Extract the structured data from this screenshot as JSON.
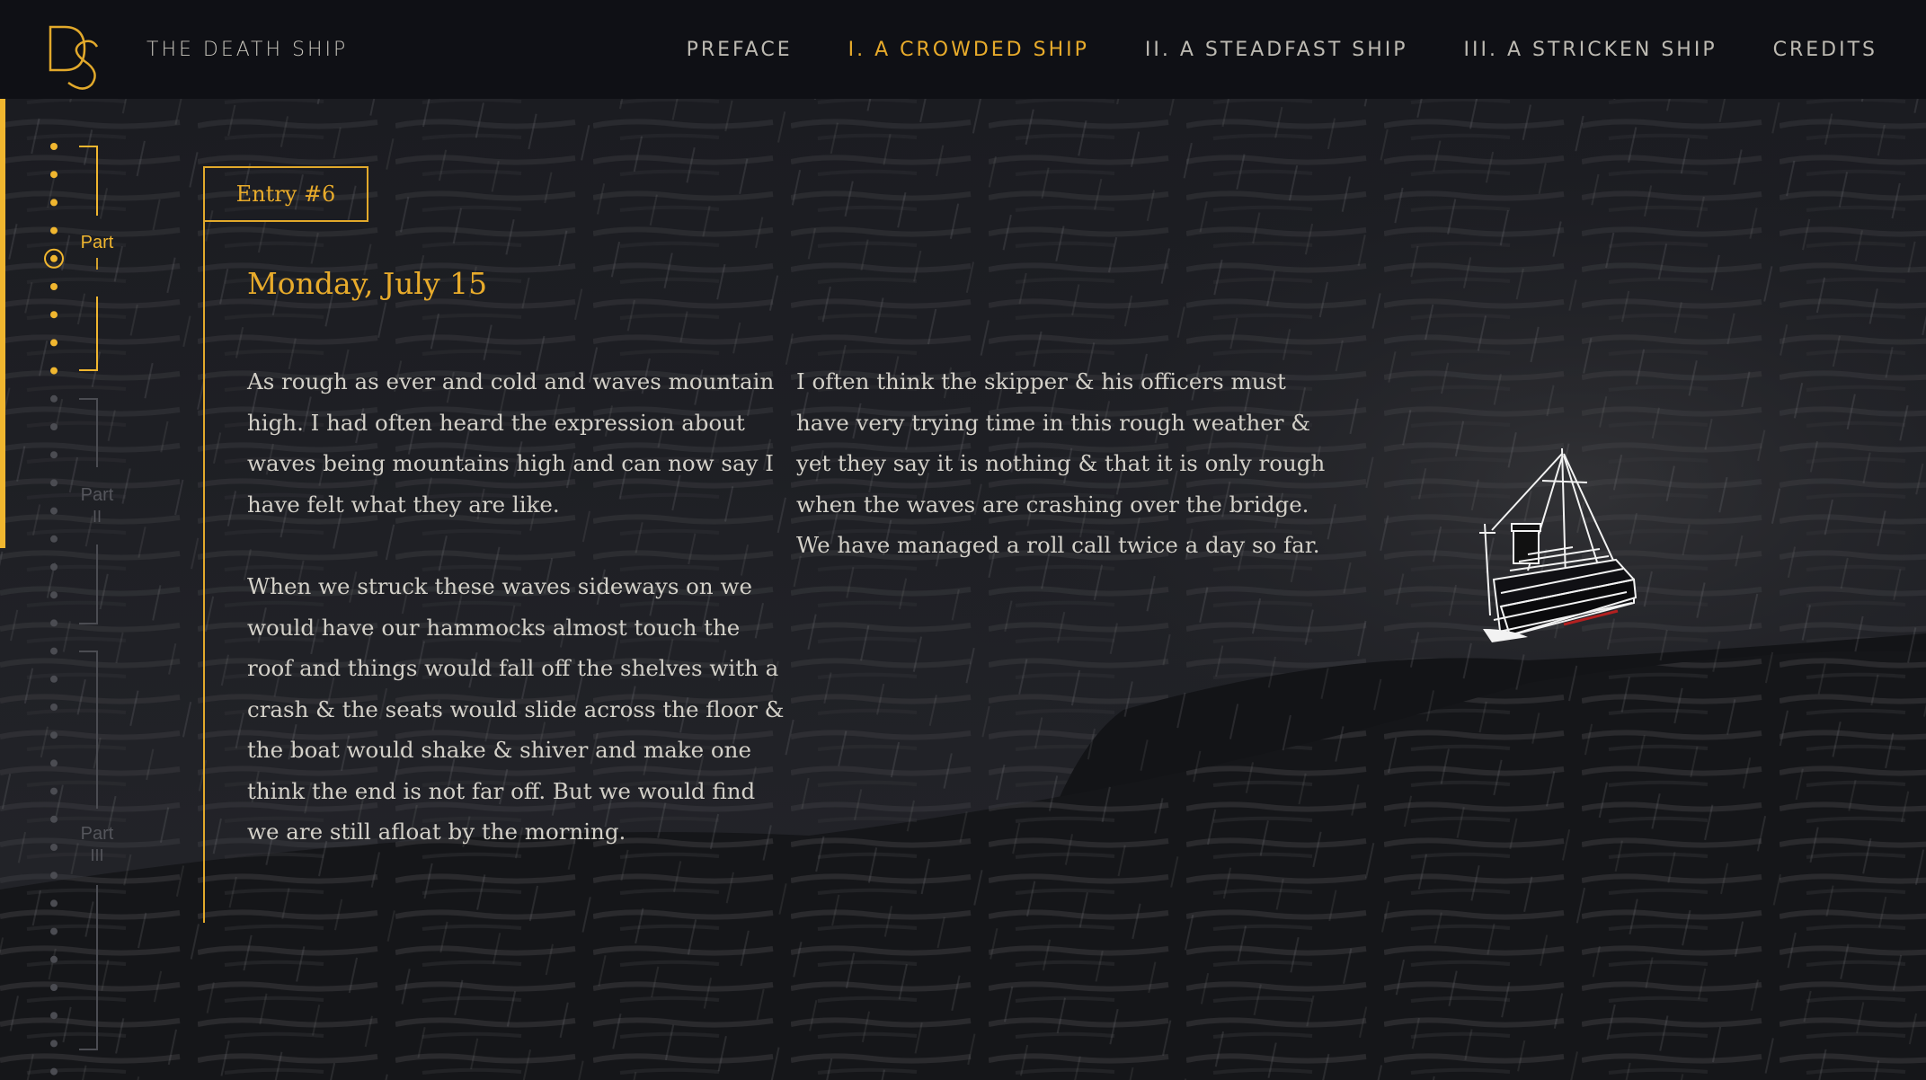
{
  "header": {
    "logo_letters": "DS",
    "site_title": "THE DEATH SHIP",
    "nav": [
      {
        "label": "PREFACE",
        "active": false
      },
      {
        "label": "I. A CROWDED SHIP",
        "active": true
      },
      {
        "label": "II. A STEADFAST SHIP",
        "active": false
      },
      {
        "label": "III. A STRICKEN SHIP",
        "active": false
      },
      {
        "label": "CREDITS",
        "active": false
      }
    ]
  },
  "progress": {
    "parts": [
      {
        "label_top": "Part",
        "label_num": "I",
        "active": true
      },
      {
        "label_top": "Part",
        "label_num": "II",
        "active": false
      },
      {
        "label_top": "Part",
        "label_num": "III",
        "active": false
      }
    ],
    "accent_color": "#f0b62f",
    "inactive_color": "#4b4c52"
  },
  "entry": {
    "tab_label": "Entry #6",
    "date": "Monday, July 15",
    "left_paragraphs": [
      "As rough as ever and cold and waves mountain high. I had often heard the expression about waves being mountains high and can now say I have felt what they are like.",
      "When we struck these waves sideways on we would have our hammocks almost touch the roof and things would fall off the shelves with a crash & the seats would slide across the floor & the boat would shake & shiver and make one think the end is not far off. But we would find we are still afloat by the morning."
    ],
    "right_paragraphs": [
      "I often think the skipper & his officers must have very trying time in this rough weather & yet they say it is nothing & that it is only rough when the waves are crashing over the bridge. We have managed a roll call twice a day so far."
    ]
  },
  "colors": {
    "accent": "#e8ab2b",
    "background": "#141519",
    "text": "#d3d0c8"
  }
}
